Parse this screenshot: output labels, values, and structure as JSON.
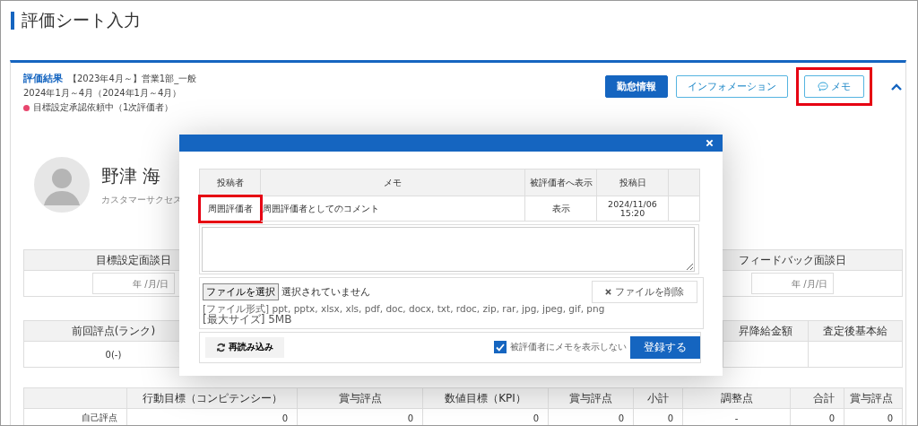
{
  "page_title": "評価シート入力",
  "card": {
    "title": "評価結果",
    "period_label": "【2023年4月～】営業1部_一般",
    "date_range": "2024年1月～4月（2024年1月～4月）",
    "status": {
      "text": "目標設定承認依頼中（1次評価者）",
      "color": "#e8466e"
    },
    "buttons": [
      {
        "label": "勤怠情報",
        "kind": "primary",
        "highlighted": false
      },
      {
        "label": "インフォメーション",
        "kind": "outline",
        "highlighted": false
      },
      {
        "label": "メモ",
        "kind": "memo",
        "highlighted": true
      }
    ],
    "expanded": true
  },
  "profile": {
    "name": "野津 海",
    "department": "カスタマーサクセス"
  },
  "interview_dates": [
    {
      "label": "目標設定面談日",
      "placeholder": "年 /月/日"
    },
    {
      "label": "フィードバック面談日",
      "placeholder": "年 /月/日"
    }
  ],
  "rank_table": {
    "first": {
      "header": "前回評点(ランク)",
      "value": "0(-)"
    },
    "last_headers": [
      "昇降給金額",
      "査定後基本給"
    ]
  },
  "score_table": {
    "columns": [
      "行動目標（コンピテンシー）",
      "賞与評点",
      "数値目標（KPI）",
      "賞与評点",
      "小計",
      "調整点",
      "合計",
      "賞与評点"
    ],
    "row_label": "自己評点",
    "values": [
      "0",
      "0",
      "0",
      "0",
      "0",
      "-",
      "0",
      "0"
    ]
  },
  "memo_dialog": {
    "columns": [
      "投稿者",
      "メモ",
      "被評価者へ表示",
      "投稿日"
    ],
    "rows": [
      {
        "author": "周囲評価者",
        "memo": "周囲評価者としてのコメント",
        "visibility": "表示",
        "date": "2024/11/06 15:20",
        "author_highlighted": true
      }
    ],
    "file": {
      "choose_label": "ファイルを選択",
      "status": "選択されていません",
      "delete_label": "ファイルを削除",
      "formats": "[ファイル形式] ppt, pptx, xlsx, xls, pdf, doc, docx, txt, rdoc, zip, rar, jpg, jpeg, gif, png",
      "max_size": "[最大サイズ] 5MB"
    },
    "reload_label": "再読み込み",
    "hide_from_evaluatee": {
      "label": "被評価者にメモを表示しない",
      "checked": true
    },
    "submit_label": "登録する"
  }
}
